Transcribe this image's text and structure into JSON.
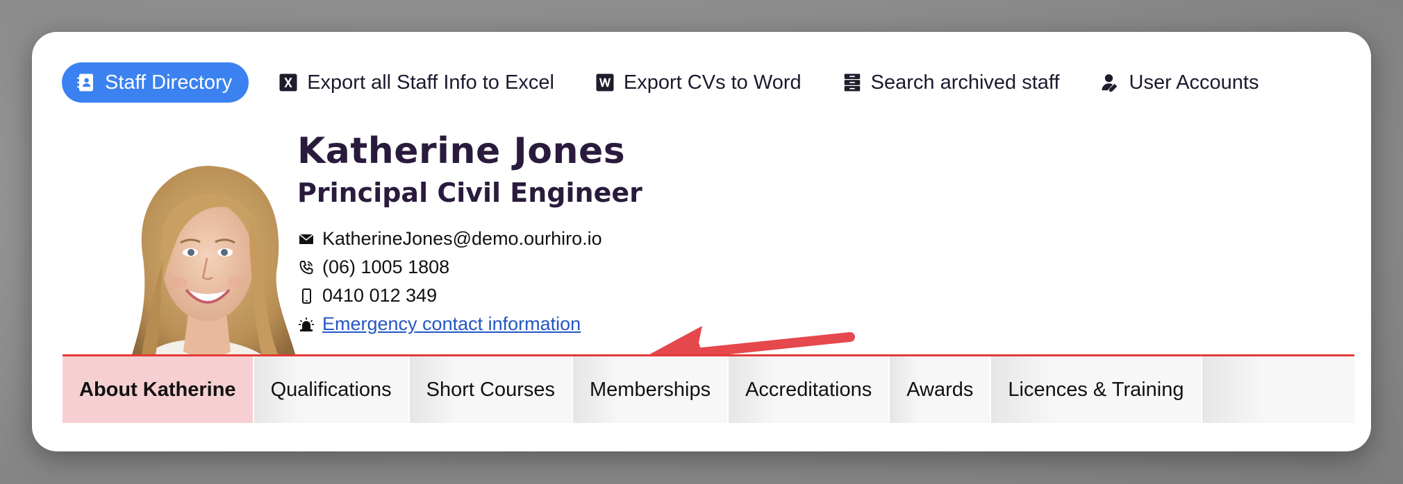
{
  "toolbar": {
    "items": [
      {
        "label": "Staff Directory",
        "icon": "address-book-icon"
      },
      {
        "label": "Export all Staff Info to Excel",
        "icon": "excel-icon"
      },
      {
        "label": "Export CVs to Word",
        "icon": "word-icon"
      },
      {
        "label": "Search archived staff",
        "icon": "archive-icon"
      },
      {
        "label": "User Accounts",
        "icon": "user-edit-icon"
      }
    ]
  },
  "profile": {
    "name": "Katherine Jones",
    "title": "Principal Civil Engineer",
    "email": "KatherineJones@demo.ourhiro.io",
    "phone": "(06) 1005 1808",
    "mobile": "0410 012 349",
    "emergency_link": "Emergency contact information"
  },
  "tabs": [
    {
      "label": "About Katherine",
      "active": true
    },
    {
      "label": "Qualifications",
      "active": false
    },
    {
      "label": "Short Courses",
      "active": false
    },
    {
      "label": "Memberships",
      "active": false
    },
    {
      "label": "Accreditations",
      "active": false
    },
    {
      "label": "Awards",
      "active": false
    },
    {
      "label": "Licences & Training",
      "active": false
    }
  ],
  "colors": {
    "accent": "#3b82f0",
    "name_text": "#2a1b3d",
    "tab_active": "#f6cfd2",
    "tab_border": "#e53935",
    "link": "#2456c4",
    "annotation_arrow": "#e5484d"
  }
}
